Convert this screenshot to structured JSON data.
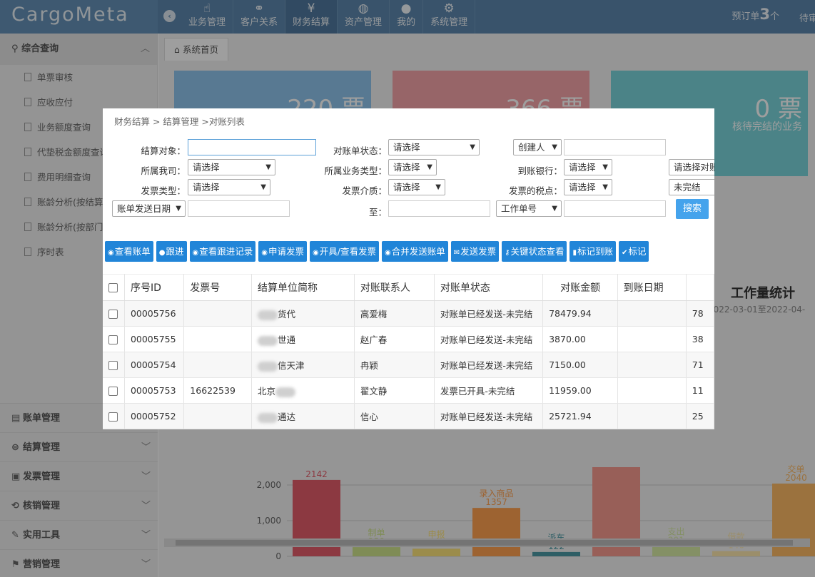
{
  "app": {
    "logo": "CargoMeta",
    "nav": [
      {
        "label": "业务管理",
        "icon": "hand-icon",
        "glyph": "☝"
      },
      {
        "label": "客户关系",
        "icon": "handshake-icon",
        "glyph": "🤝"
      },
      {
        "label": "财务结算",
        "icon": "yen-icon",
        "glyph": "¥"
      },
      {
        "label": "资产管理",
        "icon": "ball-icon",
        "glyph": "◍"
      },
      {
        "label": "我的",
        "icon": "user-icon",
        "glyph": "●"
      },
      {
        "label": "系统管理",
        "icon": "gear-icon",
        "glyph": "⚙"
      }
    ],
    "preorder_prefix": "预订单",
    "preorder_count": "3",
    "preorder_suffix": "个",
    "pending_label": "待审核"
  },
  "sidebar": {
    "head": "综合查询",
    "items": [
      "单票审核",
      "应收应付",
      "业务额度查询",
      "代垫税金额度查询",
      "费用明细查询",
      "账龄分析(按结算单位)",
      "账龄分析(按部门)",
      "序时表"
    ],
    "sections": [
      "账单管理",
      "结算管理",
      "发票管理",
      "核销管理",
      "实用工具",
      "营销管理"
    ]
  },
  "main": {
    "tab": "系统首页",
    "cards": [
      {
        "num": "220 票",
        "desc": "",
        "color": "#8fc4ec"
      },
      {
        "num": "366 票",
        "desc": "",
        "color": "#f4a3a8"
      },
      {
        "num": "0 票",
        "desc": "核待完结的业务",
        "color": "#7ad4da"
      }
    ],
    "workstat_title": "工作量统计",
    "workstat_range": "2022-03-01至2022-04-"
  },
  "chart_data": {
    "type": "bar",
    "categories": [
      "",
      "制单",
      "申报",
      "录入商品",
      "派车",
      "",
      "支出",
      "借款",
      "交单"
    ],
    "values": [
      2142,
      258,
      213,
      1357,
      122,
      2500,
      291,
      146,
      2040
    ],
    "colors": [
      "#e35d6a",
      "#cde28b",
      "#fbe27a",
      "#fea04f",
      "#4b98a4",
      "#f69a8f",
      "#d6e8a4",
      "#fbe5ab",
      "#fbb965"
    ],
    "yticks": [
      0,
      1000,
      2000
    ],
    "ylim": [
      0,
      2500
    ],
    "ylabels": [
      "0",
      "1,000",
      "2,000"
    ]
  },
  "modal": {
    "breadcrumb": "财务结算 > 结算管理 >对账列表",
    "filters": {
      "settle_target_label": "结算对象：",
      "statement_status_label": "对账单状态：",
      "statement_status_value": "请选择",
      "creator_select": "创建人",
      "our_company_label": "所属我司：",
      "our_company_value": "请选择",
      "biz_type_label": "所属业务类型：",
      "biz_type_value": "请选择",
      "arrival_bank_label": "到账银行：",
      "arrival_bank_value": "请选择",
      "reconcile_value": "请选择对账",
      "invoice_type_label": "发票类型：",
      "invoice_type_value": "请选择",
      "invoice_medium_label": "发票介质：",
      "invoice_medium_value": "请选择",
      "invoice_tax_label": "发票的税点：",
      "invoice_tax_value": "请选择",
      "completion_value": "未完结",
      "send_date_select": "账单发送日期",
      "to_label": "至：",
      "work_no_select": "工作单号",
      "search_label": "搜索"
    },
    "actions": [
      "查看账单",
      "跟进",
      "查看跟进记录",
      "申请发票",
      "开具/查看发票",
      "合并发送账单",
      "发送发票",
      "关键状态查看",
      "标记到账",
      "标记"
    ],
    "columns": [
      "序号ID",
      "发票号",
      "结算单位简称",
      "对账联系人",
      "对账单状态",
      "对账金额",
      "到账日期",
      ""
    ],
    "rows": [
      {
        "id": "00005756",
        "invoice": "",
        "unit": "货代",
        "contact": "高爱梅",
        "status": "对账单已经发送-未完结",
        "amount": "78479.94",
        "date": "",
        "extra": "78"
      },
      {
        "id": "00005755",
        "invoice": "",
        "unit": "世通",
        "contact": "赵广春",
        "status": "对账单已经发送-未完结",
        "amount": "3870.00",
        "date": "",
        "extra": "38"
      },
      {
        "id": "00005754",
        "invoice": "",
        "unit": "信天津",
        "contact": "冉颖",
        "status": "对账单已经发送-未完结",
        "amount": "7150.00",
        "date": "",
        "extra": "71"
      },
      {
        "id": "00005753",
        "invoice": "16622539",
        "unit": "北京",
        "contact": "翟文静",
        "status": "发票已开具-未完结",
        "amount": "11959.00",
        "date": "",
        "extra": "11"
      },
      {
        "id": "00005752",
        "invoice": "",
        "unit": "通达",
        "contact": "信心",
        "status": "对账单已经发送-未完结",
        "amount": "25721.94",
        "date": "",
        "extra": "25"
      }
    ]
  }
}
